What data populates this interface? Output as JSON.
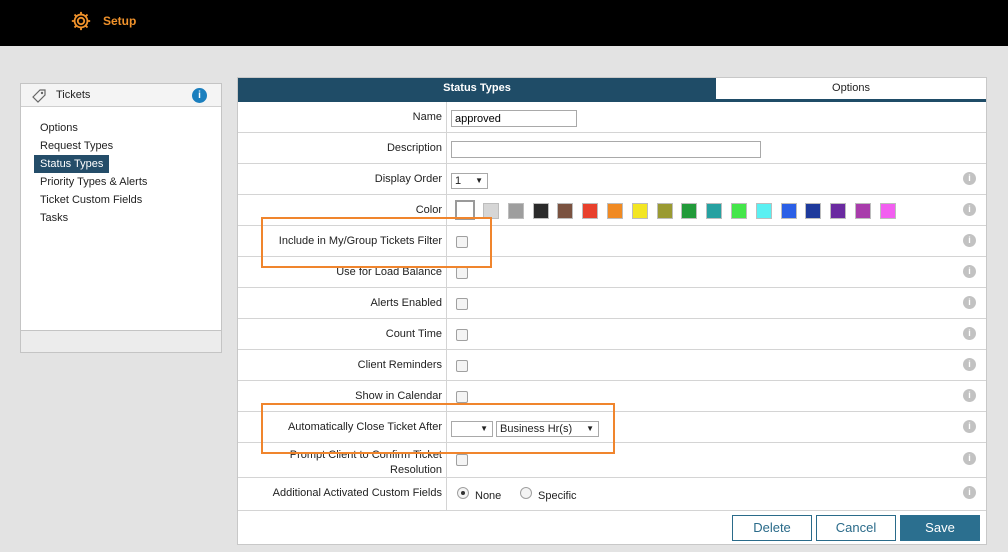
{
  "header": {
    "title": "Setup",
    "icon": "gear-icon",
    "accent": "#f0922b"
  },
  "sidebar": {
    "title": "Tickets",
    "info_icon": "i",
    "items": [
      {
        "label": "Options"
      },
      {
        "label": "Request Types"
      },
      {
        "label": "Status Types",
        "active": true
      },
      {
        "label": "Priority Types & Alerts"
      },
      {
        "label": "Ticket Custom Fields"
      },
      {
        "label": "Tasks"
      }
    ]
  },
  "tabs": [
    {
      "label": "Status Types",
      "active": true
    },
    {
      "label": "Options"
    }
  ],
  "form": {
    "name": {
      "label": "Name",
      "value": "approved"
    },
    "description": {
      "label": "Description",
      "value": ""
    },
    "display_order": {
      "label": "Display Order",
      "value": "1",
      "arrow": "▼"
    },
    "color": {
      "label": "Color",
      "swatches": [
        "#ffffff",
        "#d6d6d6",
        "#9e9e9e",
        "#2a2a2a",
        "#7a5240",
        "#e8402c",
        "#f08a23",
        "#f3e623",
        "#9a9a32",
        "#229a3a",
        "#26a1a1",
        "#44e64a",
        "#5af0f2",
        "#2a5fe6",
        "#1e3a9c",
        "#6a2aa0",
        "#a83cab",
        "#f25ef0"
      ]
    },
    "include_filter": {
      "label": "Include in My/Group Tickets Filter"
    },
    "load_balance": {
      "label": "Use for Load Balance"
    },
    "alerts_enabled": {
      "label": "Alerts Enabled"
    },
    "count_time": {
      "label": "Count Time"
    },
    "client_reminders": {
      "label": "Client Reminders"
    },
    "show_calendar": {
      "label": "Show in Calendar"
    },
    "auto_close": {
      "label": "Automatically Close Ticket After",
      "amount": "",
      "unit": "Business Hr(s)",
      "arrow": "▼"
    },
    "prompt_client": {
      "label_line1": "Prompt Client to Confirm Ticket",
      "label_line2": "Resolution"
    },
    "custom_fields": {
      "label": "Additional Activated Custom Fields",
      "options": [
        "None",
        "Specific"
      ],
      "selected": "None"
    }
  },
  "hint_icon": "i",
  "buttons": {
    "delete": "Delete",
    "cancel": "Cancel",
    "save": "Save"
  },
  "highlight_color": "#f0852d"
}
